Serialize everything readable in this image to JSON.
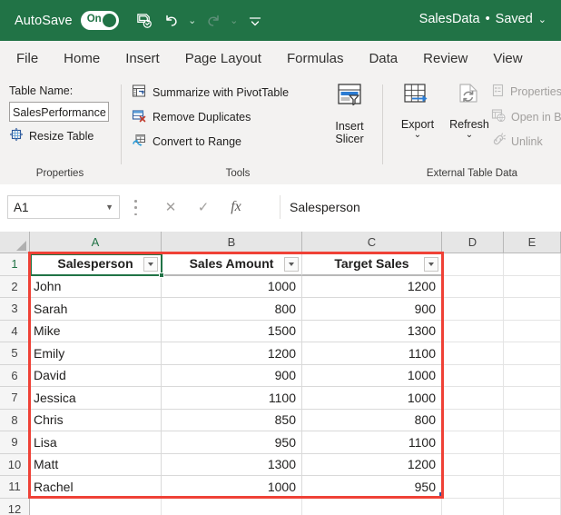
{
  "titlebar": {
    "autosave_label": "AutoSave",
    "toggle_state": "On",
    "save_icon": "save-icon",
    "undo_icon": "undo-icon",
    "redo_icon": "redo-icon",
    "customize_icon": "customize-quick-access-icon",
    "document_name": "SalesData",
    "separator": "•",
    "save_status": "Saved",
    "title_chevron": "⌄",
    "background_color": "#217346"
  },
  "tabs": [
    {
      "label": "File"
    },
    {
      "label": "Home"
    },
    {
      "label": "Insert"
    },
    {
      "label": "Page Layout"
    },
    {
      "label": "Formulas"
    },
    {
      "label": "Data"
    },
    {
      "label": "Review"
    },
    {
      "label": "View"
    }
  ],
  "ribbon": {
    "groups": [
      {
        "name": "Properties"
      },
      {
        "name": "Tools"
      },
      {
        "name": "External Table Data"
      }
    ],
    "table_name_label": "Table Name:",
    "table_name_value": "SalesPerformance",
    "resize_table": "Resize Table",
    "summarize_pivottable": "Summarize with PivotTable",
    "remove_duplicates": "Remove Duplicates",
    "convert_to_range": "Convert to Range",
    "insert_slicer_line1": "Insert",
    "insert_slicer_line2": "Slicer",
    "export_label": "Export",
    "refresh_label": "Refresh",
    "dropdown_chevron": "⌄",
    "properties_label": "Properties",
    "open_in_browser_label": "Open in Browser",
    "unlink_label": "Unlink"
  },
  "formula_bar": {
    "name_box_value": "A1",
    "name_box_chevron": "▼",
    "cancel_icon": "✕",
    "enter_icon": "✓",
    "function_icon": "fx",
    "formula_value": "Salesperson"
  },
  "grid": {
    "column_headers": [
      "A",
      "B",
      "C",
      "D",
      "E"
    ],
    "selected_column": "A",
    "selected_row": "1",
    "row_numbers": [
      "1",
      "2",
      "3",
      "4",
      "5",
      "6",
      "7",
      "8",
      "9",
      "10",
      "11",
      "12"
    ],
    "table_headers": [
      "Salesperson",
      "Sales Amount",
      "Target Sales"
    ],
    "rows": [
      {
        "row": "2",
        "salesperson": "John",
        "sales_amount": "1000",
        "target_sales": "1200"
      },
      {
        "row": "3",
        "salesperson": "Sarah",
        "sales_amount": "800",
        "target_sales": "900"
      },
      {
        "row": "4",
        "salesperson": "Mike",
        "sales_amount": "1500",
        "target_sales": "1300"
      },
      {
        "row": "5",
        "salesperson": "Emily",
        "sales_amount": "1200",
        "target_sales": "1100"
      },
      {
        "row": "6",
        "salesperson": "David",
        "sales_amount": "900",
        "target_sales": "1000"
      },
      {
        "row": "7",
        "salesperson": "Jessica",
        "sales_amount": "1100",
        "target_sales": "1000"
      },
      {
        "row": "8",
        "salesperson": "Chris",
        "sales_amount": "850",
        "target_sales": "800"
      },
      {
        "row": "9",
        "salesperson": "Lisa",
        "sales_amount": "950",
        "target_sales": "1100"
      },
      {
        "row": "10",
        "salesperson": "Matt",
        "sales_amount": "1300",
        "target_sales": "1200"
      },
      {
        "row": "11",
        "salesperson": "Rachel",
        "sales_amount": "1000",
        "target_sales": "950"
      }
    ],
    "selection_color": "#217346",
    "highlight_color": "#ef4136"
  }
}
